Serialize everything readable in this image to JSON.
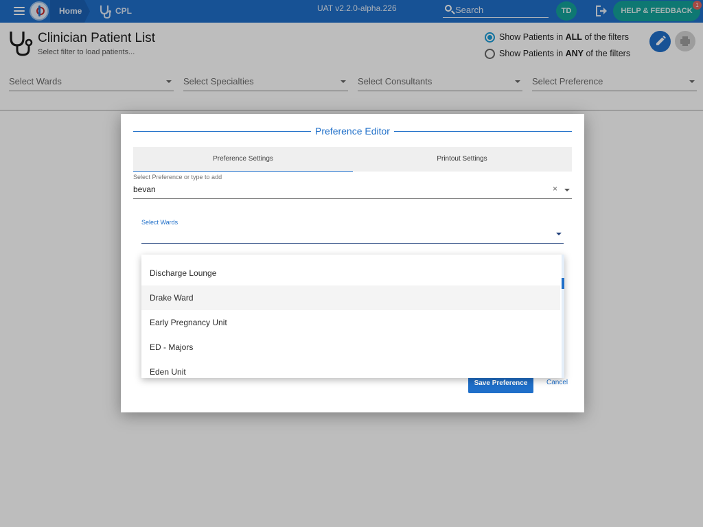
{
  "topbar": {
    "home_label": "Home",
    "module_label": "CPL",
    "environment": "UAT v2.2.0-alpha.226",
    "search_placeholder": "Search",
    "avatar_initials": "TD",
    "help_label": "HELP & FEEDBACK",
    "notification_count": "1",
    "brand_color": "#1f6fc9",
    "accent_color": "#14a39a",
    "icons": [
      "menu-icon",
      "app-logo-icon",
      "stethoscope-icon",
      "search-icon",
      "logout-icon",
      "pencil-icon",
      "printer-icon"
    ]
  },
  "page": {
    "title": "Clinician Patient List",
    "subtitle": "Select filter to load patients...",
    "filter_mode_all_prefix": "Show Patients in ",
    "filter_mode_all_bold": "ALL",
    "filter_mode_all_suffix": " of the filters",
    "filter_mode_any_prefix": "Show Patients in ",
    "filter_mode_any_bold": "ANY",
    "filter_mode_any_suffix": " of the filters",
    "selected_mode": "ALL",
    "filters": {
      "wards": "Select Wards",
      "specialties": "Select Specialties",
      "consultants": "Select Consultants",
      "preference": "Select Preference"
    }
  },
  "dialog": {
    "title": "Preference Editor",
    "tabs": [
      {
        "label": "Preference Settings",
        "active": true
      },
      {
        "label": "Printout Settings",
        "active": false
      }
    ],
    "preference_caption": "Select Preference or type to add",
    "preference_value": "bevan",
    "clear_symbol": "×",
    "wards_caption": "Select Wards",
    "save_label": "Save Preference",
    "cancel_label": "Cancel"
  },
  "ward_options": {
    "items": [
      "Discharge Lounge",
      "Drake Ward",
      "Early Pregnancy Unit",
      "ED - Majors",
      "Eden Unit"
    ],
    "hovered": "Drake Ward"
  }
}
